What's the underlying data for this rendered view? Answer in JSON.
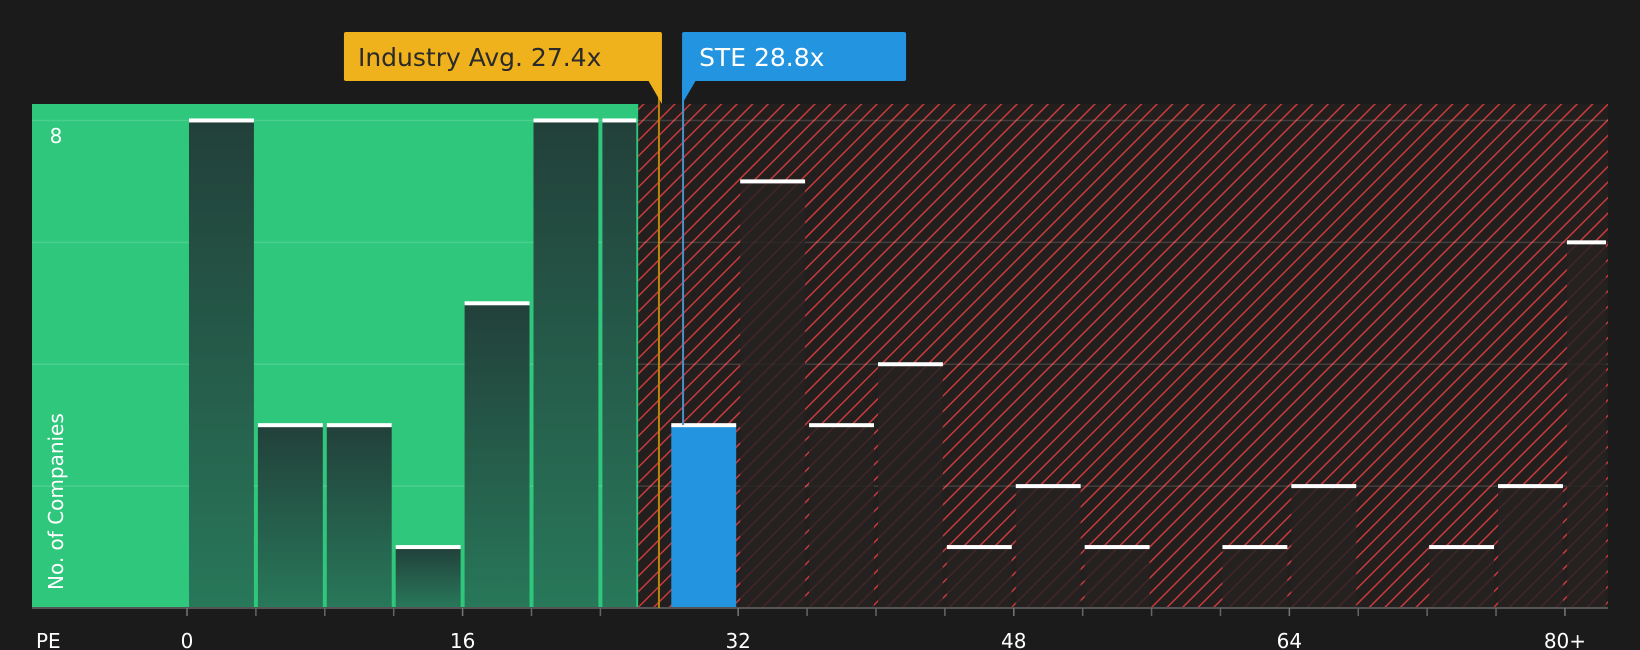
{
  "chart_data": {
    "type": "bar",
    "x_label": "PE",
    "y_label": "No. of Companies",
    "y_max_tick": "8",
    "ylim": [
      0,
      8.27
    ],
    "xlim": [
      -9.0,
      82.5
    ],
    "x_ticks": [
      {
        "value": 0,
        "label": "0"
      },
      {
        "value": 16,
        "label": "16"
      },
      {
        "value": 32,
        "label": "32"
      },
      {
        "value": 48,
        "label": "48"
      },
      {
        "value": 64,
        "label": "64"
      },
      {
        "value": 80,
        "label": "80+"
      }
    ],
    "minor_ticks": [
      4,
      8,
      12,
      20,
      24,
      36,
      40,
      44,
      52,
      56,
      60,
      68,
      72,
      76
    ],
    "bars": [
      {
        "start": 0,
        "end": 4,
        "value": 8
      },
      {
        "start": 4,
        "end": 8,
        "value": 3
      },
      {
        "start": 8,
        "end": 12,
        "value": 3
      },
      {
        "start": 12,
        "end": 16,
        "value": 1
      },
      {
        "start": 16,
        "end": 20,
        "value": 5
      },
      {
        "start": 20,
        "end": 24,
        "value": 8
      },
      {
        "start": 24,
        "end": 26.2,
        "value": 8
      },
      {
        "start": 28,
        "end": 32,
        "value": 3,
        "highlight": true
      },
      {
        "start": 32,
        "end": 36,
        "value": 7
      },
      {
        "start": 36,
        "end": 40,
        "value": 3
      },
      {
        "start": 40,
        "end": 44,
        "value": 4
      },
      {
        "start": 44,
        "end": 48,
        "value": 1
      },
      {
        "start": 48,
        "end": 52,
        "value": 2
      },
      {
        "start": 52,
        "end": 56,
        "value": 1
      },
      {
        "start": 56,
        "end": 60,
        "value": 0
      },
      {
        "start": 60,
        "end": 64,
        "value": 1
      },
      {
        "start": 64,
        "end": 68,
        "value": 2
      },
      {
        "start": 68,
        "end": 72,
        "value": 0
      },
      {
        "start": 72,
        "end": 76,
        "value": 1
      },
      {
        "start": 76,
        "end": 80,
        "value": 2
      },
      {
        "start": 80,
        "end": 82.5,
        "value": 6
      }
    ],
    "fair_region_end": 26.2,
    "industry_avg": {
      "value": 27.4,
      "label": "Industry Avg. 27.4x",
      "color": "#f0b21c"
    },
    "company": {
      "value": 28.8,
      "label": "STE 28.8x",
      "color": "#2394e0"
    },
    "colors": {
      "background": "#1b1b1b",
      "fair_region": "#2ec77c",
      "overvalued_hatch": "#c93a3a",
      "bar_dark_top": "#22403a",
      "bar_dark_bottom": "#28785a",
      "bar_red_region": "#2a2626",
      "bar_cap": "#ffffff"
    }
  }
}
